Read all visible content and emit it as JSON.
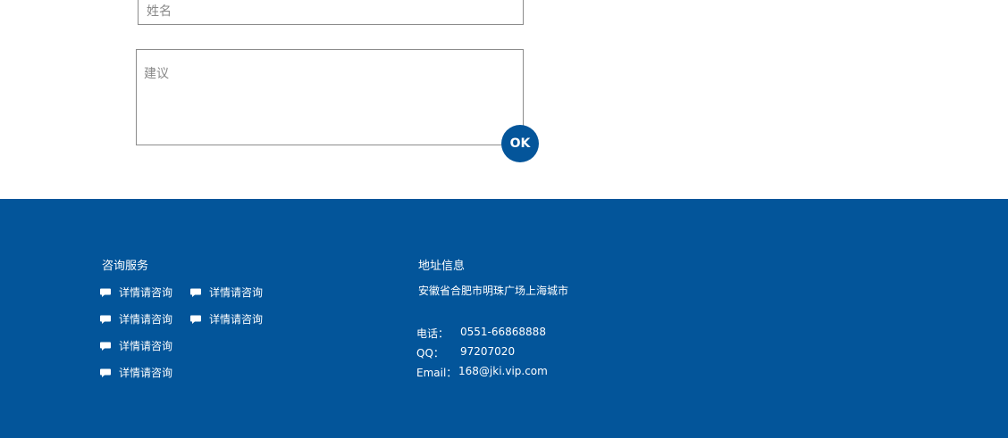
{
  "form": {
    "name_placeholder": "姓名",
    "advice_placeholder": "建议",
    "ok_label": "OK"
  },
  "footer": {
    "consult": {
      "title": "咨询服务",
      "items": [
        "详情请咨询",
        "详情请咨询",
        "详情请咨询",
        "详情请咨询",
        "详情请咨询",
        "详情请咨询"
      ]
    },
    "address": {
      "title": "地址信息",
      "address_text": "安徽省合肥市明珠广场上海城市",
      "phone_label": "电话：",
      "phone_value": "0551-66868888",
      "qq_label": "QQ：",
      "qq_value": "97207020",
      "email_label": "Email：",
      "email_value": "168@jki.vip.com"
    }
  },
  "colors": {
    "brand": "#03559a",
    "button": "#04559a"
  },
  "icons": {
    "consult_item": "speech-bubble-icon"
  }
}
